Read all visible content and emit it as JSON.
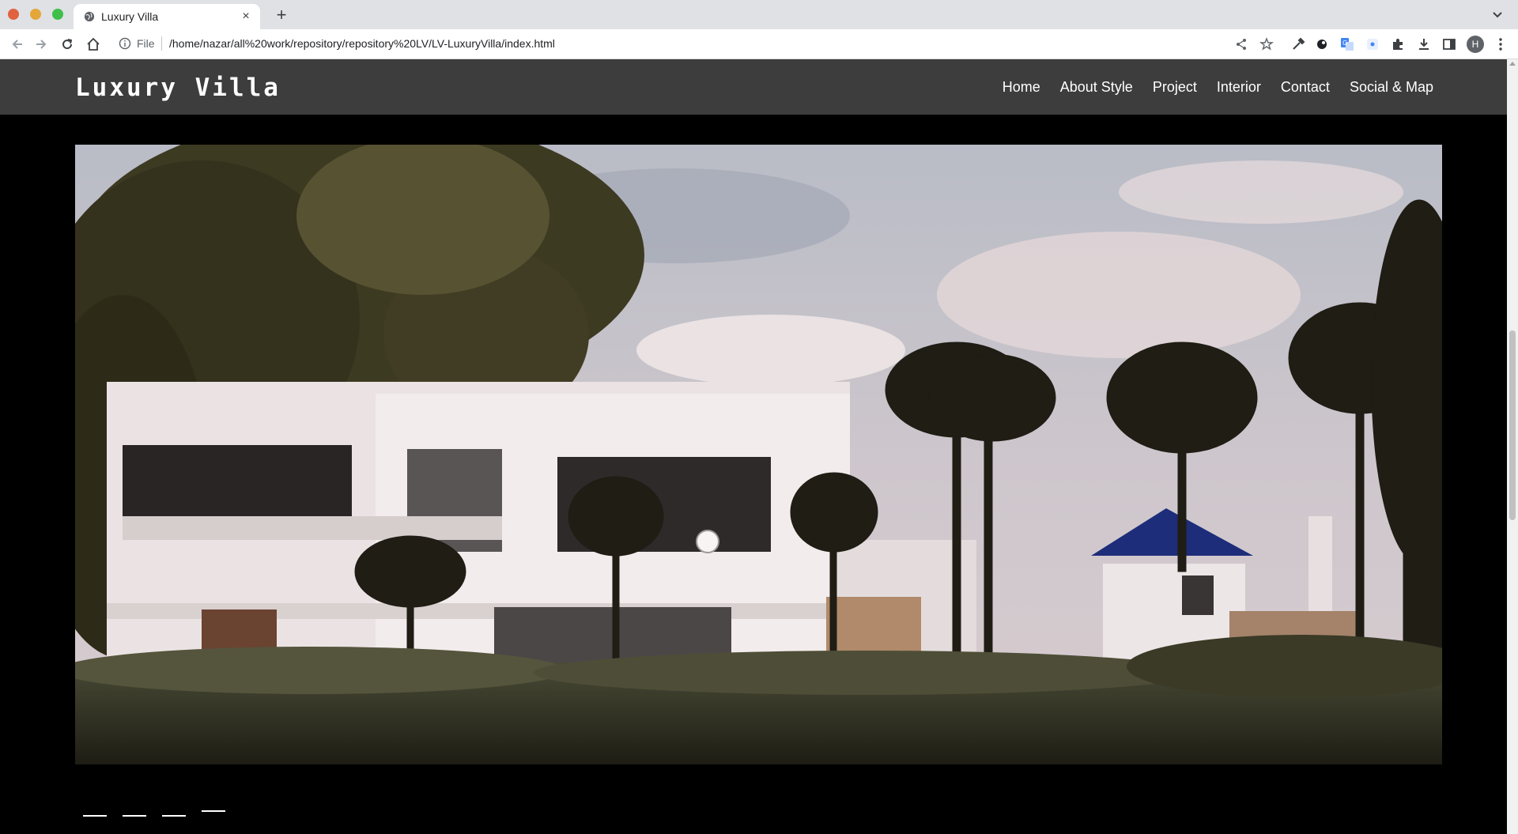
{
  "browser": {
    "tab_title": "Luxury Villa",
    "tab_close": "×",
    "new_tab": "+",
    "url_scheme": "File",
    "url": "/home/nazar/all%20work/repository/repository%20LV/LV-LuxuryVilla/index.html",
    "profile_initial": "H"
  },
  "site": {
    "brand": "Luxury Villa",
    "nav": [
      "Home",
      "About Style",
      "Project",
      "Interior",
      "Contact",
      "Social & Map"
    ]
  },
  "carousel": {
    "slide_count": 4,
    "active_index": 3
  },
  "colors": {
    "navbar": "#3d3d3d",
    "page_bg": "#000000",
    "text": "#ffffff"
  }
}
